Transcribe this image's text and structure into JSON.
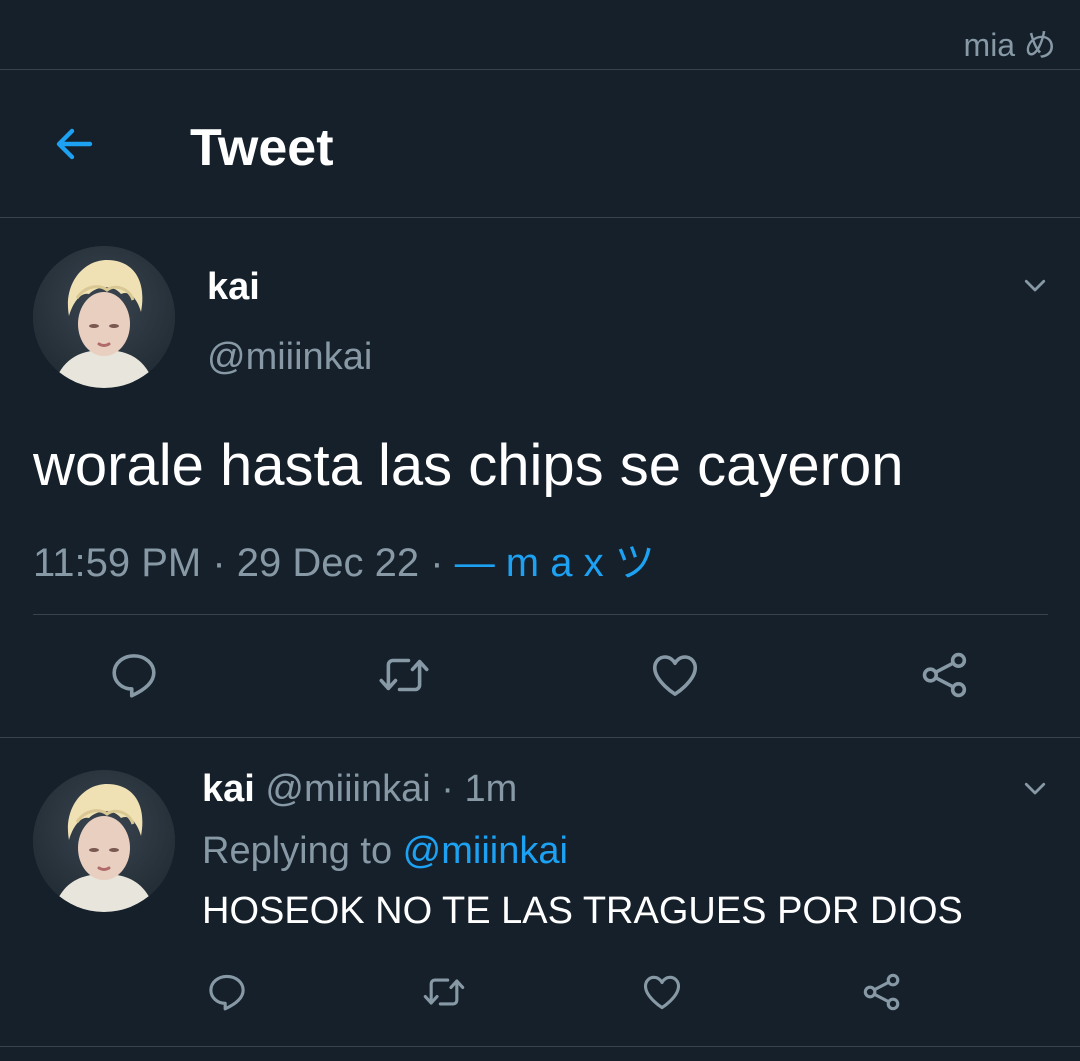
{
  "status_bar": {
    "text": "mia め"
  },
  "header": {
    "title": "Tweet",
    "back_icon": "arrow-left-icon"
  },
  "colors": {
    "background": "#15202b",
    "divider": "#38444d",
    "secondary_text": "#8899a6",
    "accent": "#1da1f2"
  },
  "main_tweet": {
    "name": "kai",
    "handle": "@miiinkai",
    "text": "worale hasta las chips se cayeron",
    "time": "11:59 PM",
    "date": "29 Dec 22",
    "separator": " · ",
    "source": "— m a x ツ",
    "actions": [
      "reply-icon",
      "retweet-icon",
      "like-icon",
      "share-icon"
    ]
  },
  "reply_tweet": {
    "name": "kai",
    "handle": "@miiinkai",
    "separator": " · ",
    "age": "1m",
    "replying_label": "Replying to ",
    "replying_mention": "@miiinkai",
    "text": "HOSEOK NO TE LAS TRAGUES POR DIOS",
    "actions": [
      "reply-icon",
      "retweet-icon",
      "like-icon",
      "share-icon"
    ]
  }
}
